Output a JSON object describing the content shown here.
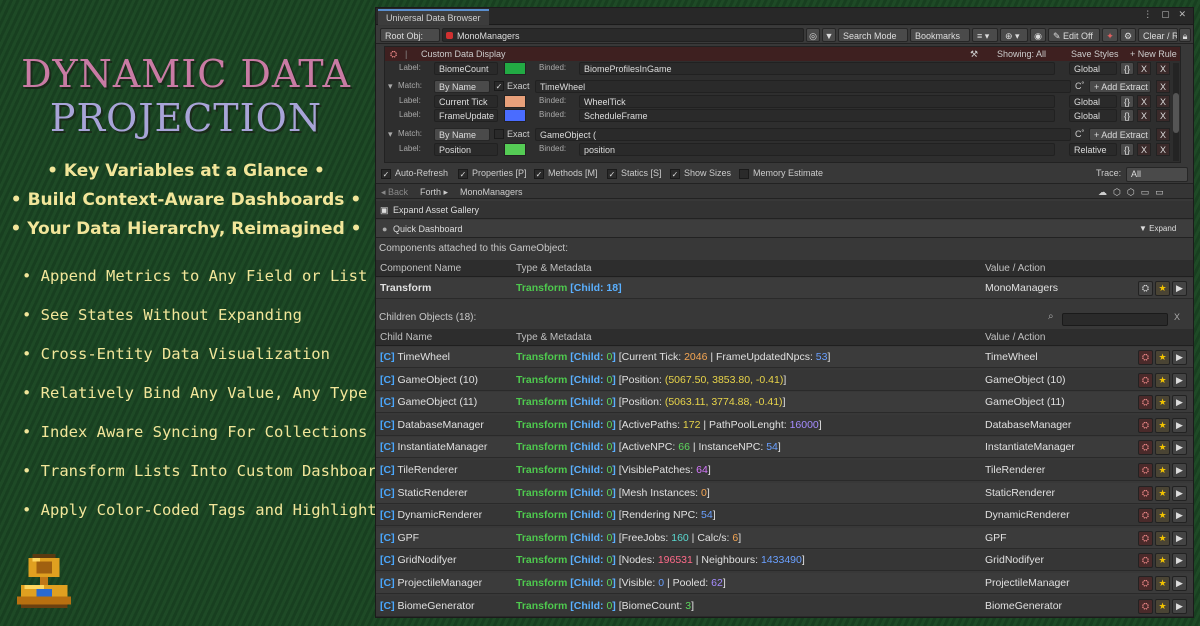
{
  "left": {
    "title_line1": "DYNAMIC DATA",
    "title_line2": "PROJECTION",
    "highlights": [
      "• Key Variables at a Glance •",
      "• Build Context-Aware Dashboards •",
      "• Your Data Hierarchy, Reimagined •"
    ],
    "features": [
      "• Append Metrics to Any Field or List",
      "• See States Without Expanding",
      "• Cross-Entity Data Visualization",
      "• Relatively Bind Any Value, Any Type",
      "• Index Aware Syncing For Collections",
      "• Transform Lists Into Custom Dashboards",
      "• Apply Color-Coded Tags and Highlights"
    ]
  },
  "window": {
    "tab_title": "Universal Data Browser",
    "titlebar_icons": "⋮ ▢ ✕"
  },
  "toolbar": {
    "root_obj_label": "Root Obj:",
    "root_obj_value": "MonoManagers",
    "search_mode": "Search Mode",
    "bookmarks": "Bookmarks",
    "edit_off": "✎ Edit Off",
    "clear_reset": "Clear / Reset"
  },
  "rules": {
    "header_title": "Custom Data Display",
    "showing": "Showing: All",
    "save_styles": "Save Styles",
    "new_rule": "+ New Rule",
    "label_text": "Label:",
    "binded_text": "Binded:",
    "match_text": "Match:",
    "exact_text": "Exact",
    "add_extract": "+ Add Extract",
    "rows": [
      {
        "label": "BiomeCount",
        "color": "#22aa44",
        "binded": "BiomeProfilesInGame",
        "scope": "Global"
      },
      {
        "match": "By Name",
        "exact": true,
        "pattern": "TimeWheel"
      },
      {
        "label": "Current Tick",
        "color": "#e8a07a",
        "binded": "WheelTick",
        "scope": "Global"
      },
      {
        "label": "FrameUpdate",
        "color": "#4a6cff",
        "binded": "ScheduleFrame",
        "scope": "Global"
      },
      {
        "match": "By Name",
        "exact": false,
        "pattern": "GameObject ("
      },
      {
        "label": "Position",
        "color": "#55cc55",
        "binded": "position",
        "scope": "Relative"
      }
    ]
  },
  "options": {
    "auto_refresh": "Auto-Refresh",
    "properties": "Properties [P]",
    "methods": "Methods [M]",
    "statics": "Statics [S]",
    "show_sizes": "Show Sizes",
    "memory_estimate": "Memory Estimate",
    "trace_label": "Trace:",
    "trace_value": "All"
  },
  "nav": {
    "back": "◂ Back",
    "forth": "Forth ▸",
    "path": "MonoManagers"
  },
  "expand_gallery": "Expand Asset Gallery",
  "quick_dashboard": "Quick Dashboard",
  "expand_label": "▼ Expand",
  "components_section": "Components attached to this GameObject:",
  "components_header": {
    "name": "Component Name",
    "type": "Type & Metadata",
    "value": "Value / Action"
  },
  "component": {
    "name": "Transform",
    "type": "Transform",
    "child": "[Child: 18]",
    "value": "MonoManagers"
  },
  "children_section": "Children Objects (18):",
  "children_header": {
    "name": "Child Name",
    "type": "Type & Metadata",
    "value": "Value / Action"
  },
  "children": [
    {
      "name": "TimeWheel",
      "child": "0",
      "p1": "Current Tick: ",
      "v1": "2046",
      "c1": "orange",
      "sep": " | ",
      "p2": "FrameUpdatedNpcs: ",
      "v2": "53",
      "c2": "blue",
      "value": "TimeWheel"
    },
    {
      "name": "GameObject (10)",
      "child": "0",
      "p1": "Position: ",
      "v1": "(5067.50, 3853.80, -0.41)",
      "c1": "yellow",
      "sep": "",
      "p2": "",
      "v2": "",
      "c2": "",
      "value": "GameObject (10)"
    },
    {
      "name": "GameObject (11)",
      "child": "0",
      "p1": "Position: ",
      "v1": "(5063.11, 3774.88, -0.41)",
      "c1": "yellow",
      "sep": "",
      "p2": "",
      "v2": "",
      "c2": "",
      "value": "GameObject (11)"
    },
    {
      "name": "DatabaseManager",
      "child": "0",
      "p1": "ActivePaths: ",
      "v1": "172",
      "c1": "yellow",
      "sep": " | ",
      "p2": "PathPoolLenght: ",
      "v2": "16000",
      "c2": "purple",
      "value": "DatabaseManager"
    },
    {
      "name": "InstantiateManager",
      "child": "0",
      "p1": "ActiveNPC: ",
      "v1": "66",
      "c1": "green",
      "sep": " | ",
      "p2": "InstanceNPC: ",
      "v2": "54",
      "c2": "blue",
      "value": "InstantiateManager"
    },
    {
      "name": "TileRenderer",
      "child": "0",
      "p1": "VisiblePatches: ",
      "v1": "64",
      "c1": "magenta",
      "sep": "",
      "p2": "",
      "v2": "",
      "c2": "",
      "value": "TileRenderer"
    },
    {
      "name": "StaticRenderer",
      "child": "0",
      "p1": "Mesh Instances: ",
      "v1": "0",
      "c1": "orange",
      "sep": "",
      "p2": "",
      "v2": "",
      "c2": "",
      "value": "StaticRenderer"
    },
    {
      "name": "DynamicRenderer",
      "child": "0",
      "p1": "Rendering NPC: ",
      "v1": "54",
      "c1": "blue",
      "sep": "",
      "p2": "",
      "v2": "",
      "c2": "",
      "value": "DynamicRenderer"
    },
    {
      "name": "GPF",
      "child": "0",
      "p1": "FreeJobs: ",
      "v1": "160",
      "c1": "teal",
      "sep": " | ",
      "p2": "Calc/s: ",
      "v2": "6",
      "c2": "orange",
      "value": "GPF"
    },
    {
      "name": "GridNodifyer",
      "child": "0",
      "p1": "Nodes: ",
      "v1": "196531",
      "c1": "pink",
      "sep": " | ",
      "p2": "Neighbours: ",
      "v2": "1433490",
      "c2": "blue",
      "value": "GridNodifyer"
    },
    {
      "name": "ProjectileManager",
      "child": "0",
      "p1": "Visible: ",
      "v1": "0",
      "c1": "blue",
      "sep": " | ",
      "p2": "Pooled: ",
      "v2": "62",
      "c2": "purple",
      "value": "ProjectileManager"
    },
    {
      "name": "BiomeGenerator",
      "child": "0",
      "p1": "BiomeCount: ",
      "v1": "3",
      "c1": "green",
      "sep": "",
      "p2": "",
      "v2": "",
      "c2": "",
      "value": "BiomeGenerator"
    }
  ],
  "tag_c": "[C]",
  "type_transform": "Transform",
  "child_prefix": "[Child: "
}
